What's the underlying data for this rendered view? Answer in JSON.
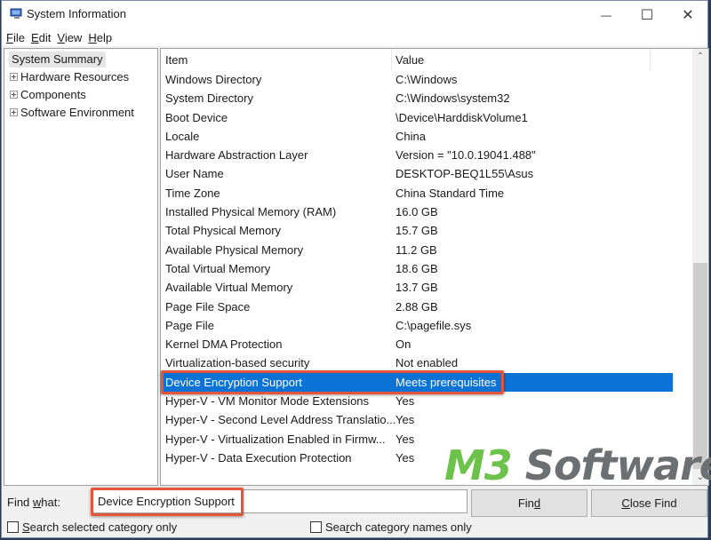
{
  "window": {
    "title": "System Information",
    "controls": {
      "minimize": "—",
      "maximize": "☐",
      "close": "✕"
    }
  },
  "menu": {
    "items": [
      {
        "label": "File",
        "mnemonic": "F",
        "rest": "ile"
      },
      {
        "label": "Edit",
        "mnemonic": "E",
        "rest": "dit"
      },
      {
        "label": "View",
        "mnemonic": "V",
        "rest": "iew"
      },
      {
        "label": "Help",
        "mnemonic": "H",
        "rest": "elp"
      }
    ]
  },
  "tree": {
    "items": [
      {
        "label": "System Summary",
        "expandable": false,
        "selected": true
      },
      {
        "label": "Hardware Resources",
        "expandable": true
      },
      {
        "label": "Components",
        "expandable": true
      },
      {
        "label": "Software Environment",
        "expandable": true
      }
    ]
  },
  "list": {
    "columns": {
      "item": "Item",
      "value": "Value"
    },
    "rows": [
      {
        "item": "Windows Directory",
        "value": "C:\\Windows"
      },
      {
        "item": "System Directory",
        "value": "C:\\Windows\\system32"
      },
      {
        "item": "Boot Device",
        "value": "\\Device\\HarddiskVolume1"
      },
      {
        "item": "Locale",
        "value": "China"
      },
      {
        "item": "Hardware Abstraction Layer",
        "value": "Version = \"10.0.19041.488\""
      },
      {
        "item": "User Name",
        "value": "DESKTOP-BEQ1L55\\Asus"
      },
      {
        "item": "Time Zone",
        "value": "China Standard Time"
      },
      {
        "item": "Installed Physical Memory (RAM)",
        "value": "16.0 GB"
      },
      {
        "item": "Total Physical Memory",
        "value": "15.7 GB"
      },
      {
        "item": "Available Physical Memory",
        "value": "11.2 GB"
      },
      {
        "item": "Total Virtual Memory",
        "value": "18.6 GB"
      },
      {
        "item": "Available Virtual Memory",
        "value": "13.7 GB"
      },
      {
        "item": "Page File Space",
        "value": "2.88 GB"
      },
      {
        "item": "Page File",
        "value": "C:\\pagefile.sys"
      },
      {
        "item": "Kernel DMA Protection",
        "value": "On"
      },
      {
        "item": "Virtualization-based security",
        "value": "Not enabled"
      },
      {
        "item": "Device Encryption Support",
        "value": "Meets prerequisites",
        "selected": true
      },
      {
        "item": "Hyper-V - VM Monitor Mode Extensions",
        "value": "Yes"
      },
      {
        "item": "Hyper-V - Second Level Address Translatio...",
        "value": "Yes"
      },
      {
        "item": "Hyper-V - Virtualization Enabled in Firmw...",
        "value": "Yes"
      },
      {
        "item": "Hyper-V - Data Execution Protection",
        "value": "Yes"
      }
    ],
    "scroll_position_fraction": 0.55
  },
  "watermark": {
    "part1": "M3",
    "part2": " Software"
  },
  "find": {
    "label_pre": "Find ",
    "label_mnemonic": "w",
    "label_post": "hat:",
    "value": "Device Encryption Support",
    "find_button": {
      "pre": "Fin",
      "mnemonic": "d",
      "post": ""
    },
    "close_button": {
      "pre": "",
      "mnemonic": "C",
      "post": "lose Find"
    },
    "checkbox_selected_category": {
      "pre": "",
      "mnemonic": "S",
      "post": "earch selected category only",
      "checked": false
    },
    "checkbox_category_names": {
      "pre": "Sea",
      "mnemonic": "r",
      "post": "ch category names only",
      "checked": false
    }
  },
  "colors": {
    "selection": "#0b72d6",
    "annotation": "#e4553a",
    "watermark_green": "#6cc24a",
    "watermark_gray": "#6d7073"
  }
}
